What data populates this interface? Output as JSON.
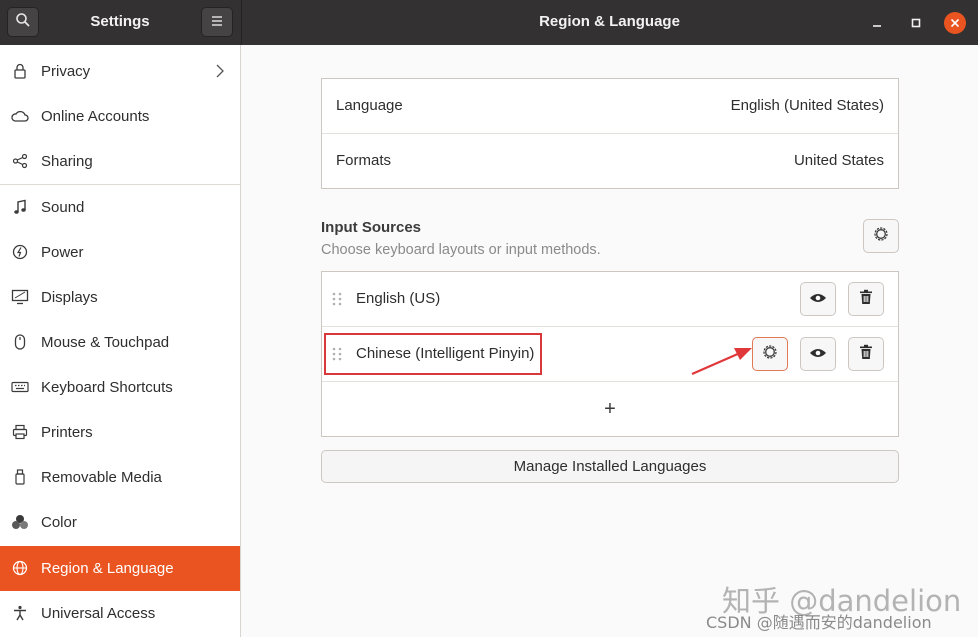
{
  "header": {
    "left_title": "Settings",
    "main_title": "Region & Language",
    "search_icon": "search-icon",
    "menu_icon": "hamburger-menu-icon",
    "window_controls": [
      "minimize-icon",
      "maximize-icon",
      "close-icon"
    ]
  },
  "sidebar": {
    "items": [
      {
        "label": "Privacy",
        "icon": "lock-icon"
      },
      {
        "label": "Online Accounts",
        "icon": "cloud-icon"
      },
      {
        "label": "Sharing",
        "icon": "share-icon"
      },
      {
        "label": "Sound",
        "icon": "music-note-icon"
      },
      {
        "label": "Power",
        "icon": "power-icon"
      },
      {
        "label": "Displays",
        "icon": "display-icon"
      },
      {
        "label": "Mouse & Touchpad",
        "icon": "mouse-icon"
      },
      {
        "label": "Keyboard Shortcuts",
        "icon": "keyboard-icon"
      },
      {
        "label": "Printers",
        "icon": "printer-icon"
      },
      {
        "label": "Removable Media",
        "icon": "usb-icon"
      },
      {
        "label": "Color",
        "icon": "color-icon"
      },
      {
        "label": "Region & Language",
        "icon": "globe-icon",
        "active": true
      },
      {
        "label": "Universal Access",
        "icon": "accessibility-icon"
      }
    ]
  },
  "region": {
    "language_label": "Language",
    "language_value": "English (United States)",
    "formats_label": "Formats",
    "formats_value": "United States"
  },
  "input_sources": {
    "title": "Input Sources",
    "subtitle": "Choose keyboard layouts or input methods.",
    "sources": [
      {
        "label": "English (US)"
      },
      {
        "label": "Chinese (Intelligent Pinyin)"
      }
    ],
    "add_label": "+",
    "manage_label": "Manage Installed Languages"
  },
  "watermark": {
    "line1": "知乎 @dandelion",
    "line2": "CSDN @随遇而安的dandelion"
  },
  "colors": {
    "accent": "#e95420",
    "header_bg": "#333131",
    "annotation_red": "#d9383a"
  }
}
